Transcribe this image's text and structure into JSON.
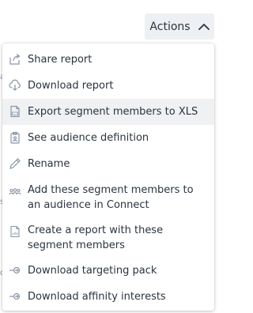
{
  "actions_button": {
    "label": "Actions"
  },
  "menu": {
    "items": [
      {
        "label": "Share report",
        "icon": "share-icon"
      },
      {
        "label": "Download report",
        "icon": "cloud-download-icon"
      },
      {
        "label": "Export segment members to XLS",
        "icon": "xls-file-icon",
        "highlighted": true
      },
      {
        "label": "See audience definition",
        "icon": "audience-definition-icon"
      },
      {
        "label": "Rename",
        "icon": "pencil-icon"
      },
      {
        "label": "Add these segment members to an audience in Connect",
        "icon": "people-group-icon"
      },
      {
        "label": "Create a report with these segment members",
        "icon": "report-file-icon"
      },
      {
        "label": "Download targeting pack",
        "icon": "arrow-download-icon"
      },
      {
        "label": "Download affinity interests",
        "icon": "arrow-download-icon"
      }
    ]
  },
  "colors": {
    "text": "#2b3440",
    "icon": "#8a96a6",
    "highlight": "#f0f1f3",
    "button_bg": "#eef0f3"
  }
}
